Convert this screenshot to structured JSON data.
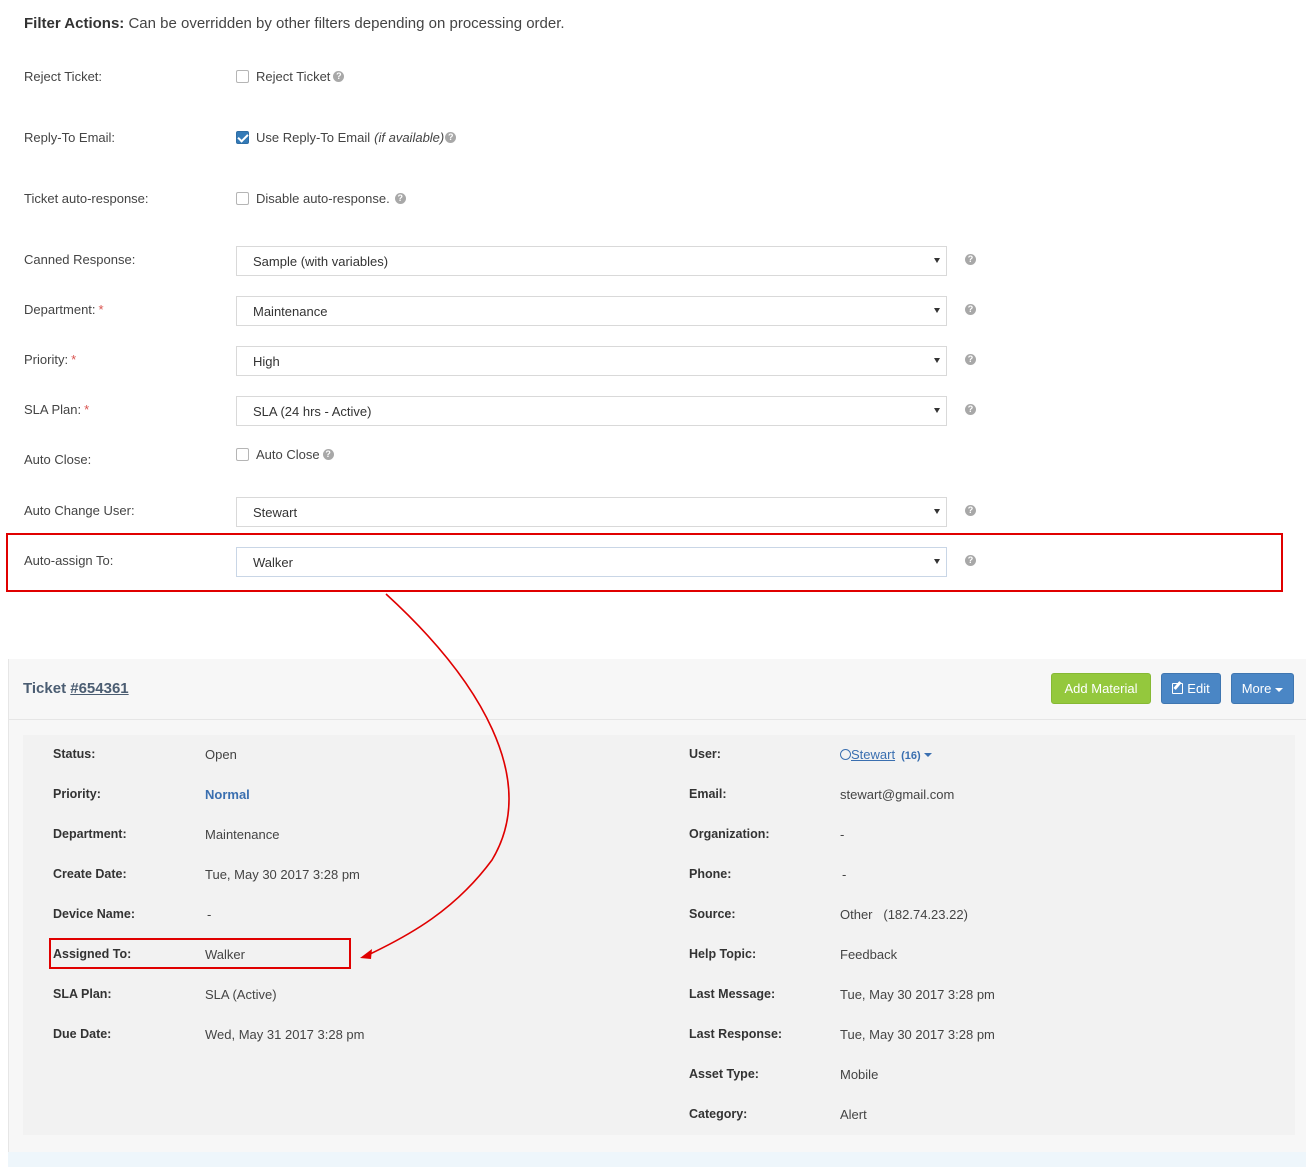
{
  "filter": {
    "heading_bold": "Filter Actions:",
    "heading_rest": " Can be overridden by other filters depending on processing order.",
    "reject_label": "Reject Ticket:",
    "reject_checkbox": "Reject Ticket",
    "reject_checked": false,
    "reply_label": "Reply-To Email:",
    "reply_checkbox": "Use Reply-To Email",
    "reply_checkbox_note": "(if available)",
    "reply_checked": true,
    "autoresp_label": "Ticket auto-response:",
    "autoresp_checkbox": "Disable auto-response.",
    "autoresp_checked": false,
    "canned_label": "Canned Response:",
    "canned_value": "Sample (with variables)",
    "dept_label": "Department:",
    "dept_value": "Maintenance",
    "priority_label": "Priority:",
    "priority_value": "High",
    "sla_label": "SLA Plan:",
    "sla_value": "SLA (24 hrs - Active)",
    "autoclose_label": "Auto Close:",
    "autoclose_checkbox": "Auto Close",
    "autoclose_checked": false,
    "changeuser_label": "Auto Change User:",
    "changeuser_value": "Stewart",
    "assign_label": "Auto-assign To:",
    "assign_value": "Walker",
    "required_mark": "*",
    "help_glyph": "?"
  },
  "ticket": {
    "title_prefix": "Ticket ",
    "number": "#654361",
    "buttons": {
      "add_material": "Add Material",
      "edit": "Edit",
      "more": "More"
    },
    "left": {
      "status_k": "Status:",
      "status_v": "Open",
      "priority_k": "Priority:",
      "priority_v": "Normal",
      "dept_k": "Department:",
      "dept_v": "Maintenance",
      "create_k": "Create Date:",
      "create_v": "Tue, May 30 2017 3:28 pm",
      "device_k": "Device Name:",
      "device_v": "-",
      "assigned_k": "Assigned To:",
      "assigned_v": "Walker",
      "sla_k": "SLA Plan:",
      "sla_v": "SLA (Active)",
      "due_k": "Due Date:",
      "due_v": "Wed, May 31 2017 3:28 pm"
    },
    "right": {
      "user_k": "User:",
      "user_v": "Stewart",
      "user_count": "(16)",
      "email_k": "Email:",
      "email_v": "stewart@gmail.com",
      "org_k": "Organization:",
      "org_v": "-",
      "phone_k": "Phone:",
      "phone_v": "-",
      "source_k": "Source:",
      "source_v": "Other",
      "source_ip": "(182.74.23.22)",
      "topic_k": "Help Topic:",
      "topic_v": "Feedback",
      "lastmsg_k": "Last Message:",
      "lastmsg_v": "Tue, May 30 2017 3:28 pm",
      "lastresp_k": "Last Response:",
      "lastresp_v": "Tue, May 30 2017 3:28 pm",
      "asset_k": "Asset Type:",
      "asset_v": "Mobile",
      "category_k": "Category:",
      "category_v": "Alert"
    }
  },
  "colors": {
    "highlight": "#e00000",
    "link": "#3a6fb0",
    "green_button": "#94c83d",
    "blue_button": "#4a86c5",
    "checkbox_checked": "#337ab7"
  }
}
